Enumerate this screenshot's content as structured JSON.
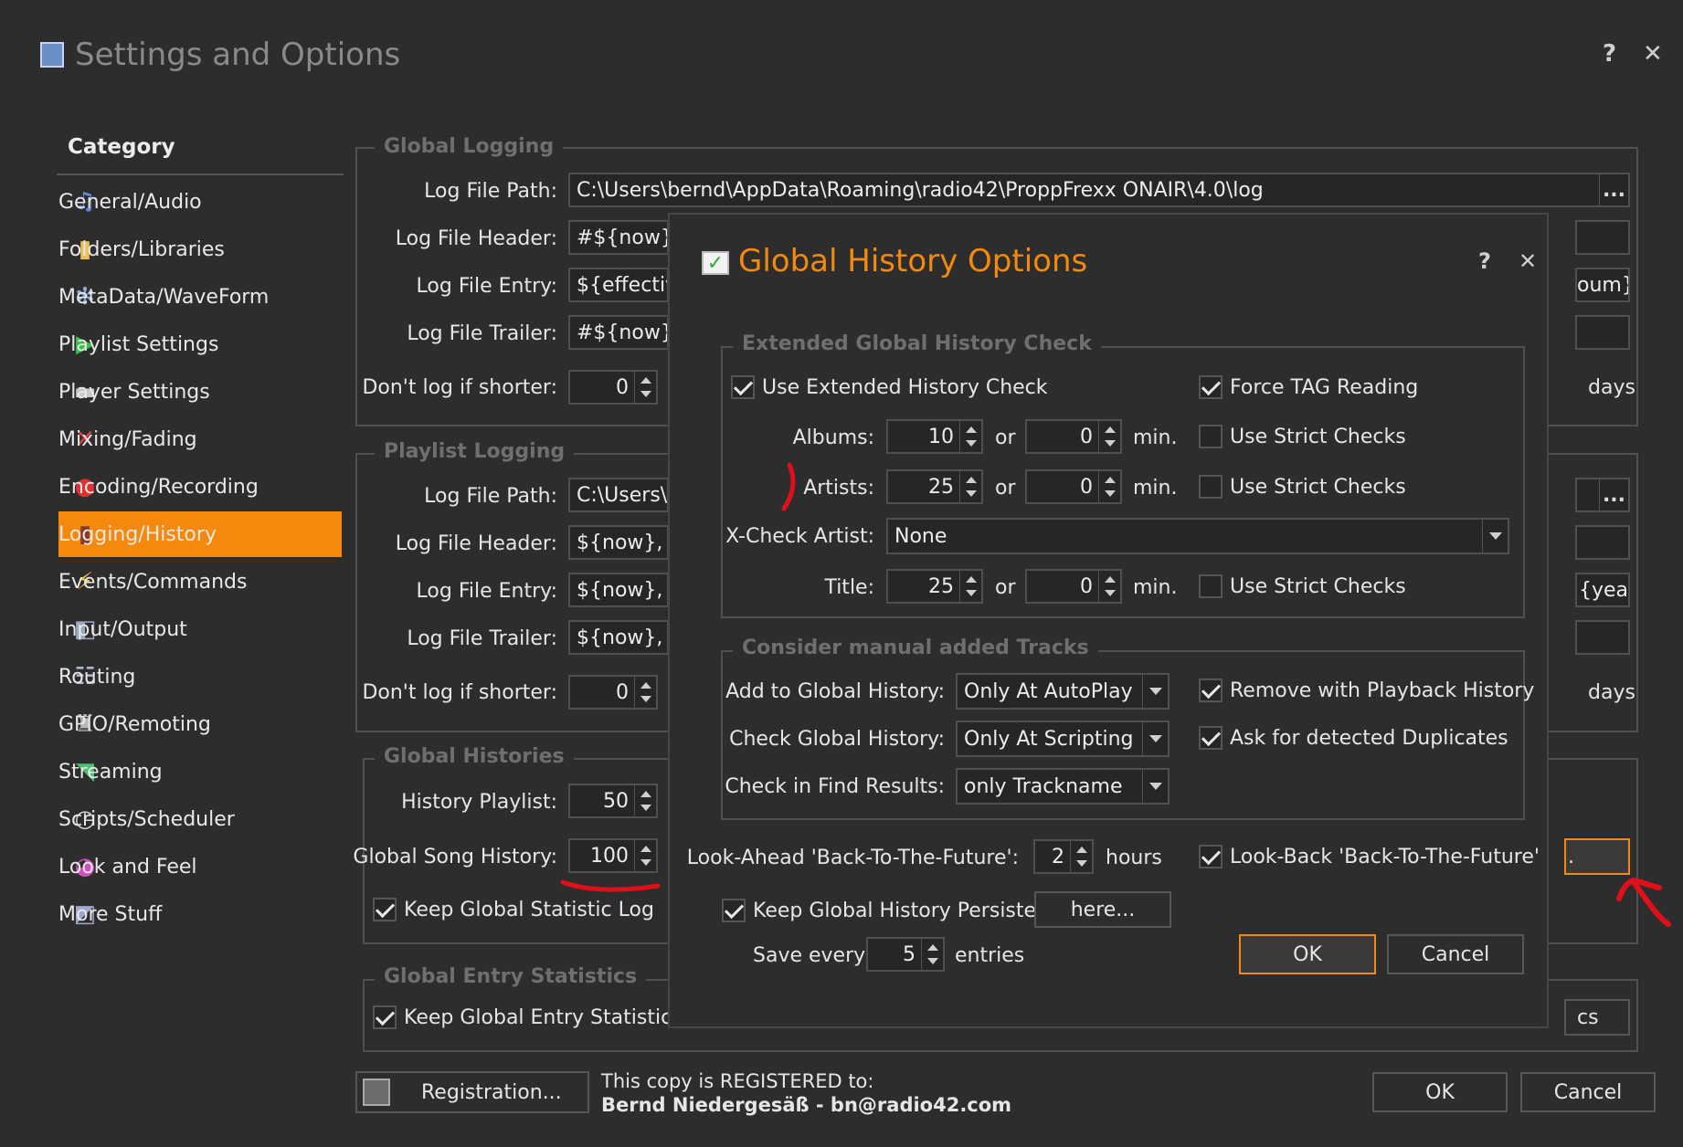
{
  "window": {
    "title": "Settings and Options",
    "help": "?",
    "close": "✕"
  },
  "sidebar": {
    "heading": "Category",
    "items": [
      {
        "label": "General/Audio",
        "icon": "music-note-icon",
        "glyph": "♫",
        "color": "#5b8fe0"
      },
      {
        "label": "Folders/Libraries",
        "icon": "folder-icon",
        "glyph": "▮",
        "color": "#e8c25a"
      },
      {
        "label": "MetaData/WaveForm",
        "icon": "waveform-icon",
        "glyph": "✻",
        "color": "#8aa6d8"
      },
      {
        "label": "Playlist Settings",
        "icon": "playlist-icon",
        "glyph": "▶",
        "color": "#3cc04a"
      },
      {
        "label": "Player Settings",
        "icon": "player-icon",
        "glyph": "▬",
        "color": "#c8c8c8"
      },
      {
        "label": "Mixing/Fading",
        "icon": "mixing-icon",
        "glyph": "✕",
        "color": "#e04040"
      },
      {
        "label": "Encoding/Recording",
        "icon": "record-icon",
        "glyph": "●",
        "color": "#e03030"
      },
      {
        "label": "Logging/History",
        "icon": "logging-icon",
        "glyph": "▮",
        "color": "#8a3a2a"
      },
      {
        "label": "Events/Commands",
        "icon": "lightning-icon",
        "glyph": "⚡",
        "color": "#f0c040"
      },
      {
        "label": "Input/Output",
        "icon": "input-output-icon",
        "glyph": "◧",
        "color": "#9aa8c0"
      },
      {
        "label": "Routing",
        "icon": "routing-icon",
        "glyph": "☷",
        "color": "#b0b8d0"
      },
      {
        "label": "GPIO/Remoting",
        "icon": "gpio-icon",
        "glyph": "♜",
        "color": "#b8b8b8"
      },
      {
        "label": "Streaming",
        "icon": "streaming-icon",
        "glyph": "◥",
        "color": "#4cc070"
      },
      {
        "label": "Scripts/Scheduler",
        "icon": "clock-icon",
        "glyph": "◷",
        "color": "#d8d8d8"
      },
      {
        "label": "Look and Feel",
        "icon": "palette-icon",
        "glyph": "◕",
        "color": "#d050c0"
      },
      {
        "label": "More Stuff",
        "icon": "more-stuff-icon",
        "glyph": "◩",
        "color": "#a0a8d0"
      }
    ],
    "active_index": 7,
    "accent": "#f5890d"
  },
  "global_logging": {
    "title": "Global Logging",
    "path_label": "Log File Path:",
    "path_value": "C:\\Users\\bernd\\AppData\\Roaming\\radio42\\ProppFrexx ONAIR\\4.0\\log",
    "header_label": "Log File Header:",
    "header_value": "#${now} v",
    "entry_label": "Log File Entry:",
    "entry_value": "${effective",
    "entry_tail": "oum}",
    "trailer_label": "Log File Trailer:",
    "trailer_value": "#${now} s",
    "shorter_label": "Don't log if shorter:",
    "shorter_value": "0",
    "days": "days",
    "browse": "..."
  },
  "playlist_logging": {
    "title": "Playlist Logging",
    "path_label": "Log File Path:",
    "path_value": "C:\\Users\\b",
    "header_label": "Log File Header:",
    "header_value": "${now}, \"$",
    "entry_label": "Log File Entry:",
    "entry_value": "${now}, \"$",
    "entry_tail": "{year",
    "trailer_label": "Log File Trailer:",
    "trailer_value": "${now}, $",
    "shorter_label": "Don't log if shorter:",
    "shorter_value": "0",
    "days": "days",
    "browse": "..."
  },
  "global_histories": {
    "title": "Global Histories",
    "history_playlist_label": "History Playlist:",
    "history_playlist_value": "50",
    "song_history_label": "Global Song History:",
    "song_history_value": "100",
    "keep_statistic_label": "Keep Global Statistic Log",
    "keep_statistic_checked": true,
    "partial_button": "."
  },
  "global_entry_statistics": {
    "title": "Global Entry Statistics",
    "keep_label": "Keep Global Entry Statistics",
    "keep_checked": true,
    "partial_button": "cs"
  },
  "footer": {
    "registration_button": "Registration...",
    "registered_line1": "This copy is REGISTERED to:",
    "registered_line2": "Bernd Niedergesäß - bn@radio42.com",
    "ok": "OK",
    "cancel": "Cancel"
  },
  "dialog": {
    "title": "Global History Options",
    "help": "?",
    "close": "✕",
    "extended": {
      "title": "Extended Global History Check",
      "use_extended_label": "Use Extended History Check",
      "use_extended_checked": true,
      "force_tag_label": "Force TAG Reading",
      "force_tag_checked": true,
      "albums_label": "Albums:",
      "albums_value": "10",
      "albums_min": "0",
      "artists_label": "Artists:",
      "artists_value": "25",
      "artists_min": "0",
      "title_label": "Title:",
      "title_value": "25",
      "title_min": "0",
      "or": "or",
      "min": "min.",
      "strict_label": "Use Strict Checks",
      "xcheck_label": "X-Check Artist:",
      "xcheck_value": "None"
    },
    "manual": {
      "title": "Consider manual added Tracks",
      "add_label": "Add to Global History:",
      "add_value": "Only At AutoPlay",
      "check_label": "Check Global History:",
      "check_value": "Only At Scripting",
      "find_label": "Check in Find Results:",
      "find_value": "only Trackname",
      "remove_label": "Remove with Playback History",
      "remove_checked": true,
      "ask_label": "Ask for detected Duplicates",
      "ask_checked": true
    },
    "lookahead_label": "Look-Ahead 'Back-To-The-Future':",
    "lookahead_value": "2",
    "hours": "hours",
    "lookback_label": "Look-Back 'Back-To-The-Future'",
    "lookback_checked": true,
    "persist_label": "Keep Global History Persistent",
    "persist_checked": true,
    "here_button": "here...",
    "save_every_label": "Save every",
    "save_every_value": "5",
    "entries": "entries",
    "ok": "OK",
    "cancel": "Cancel"
  }
}
